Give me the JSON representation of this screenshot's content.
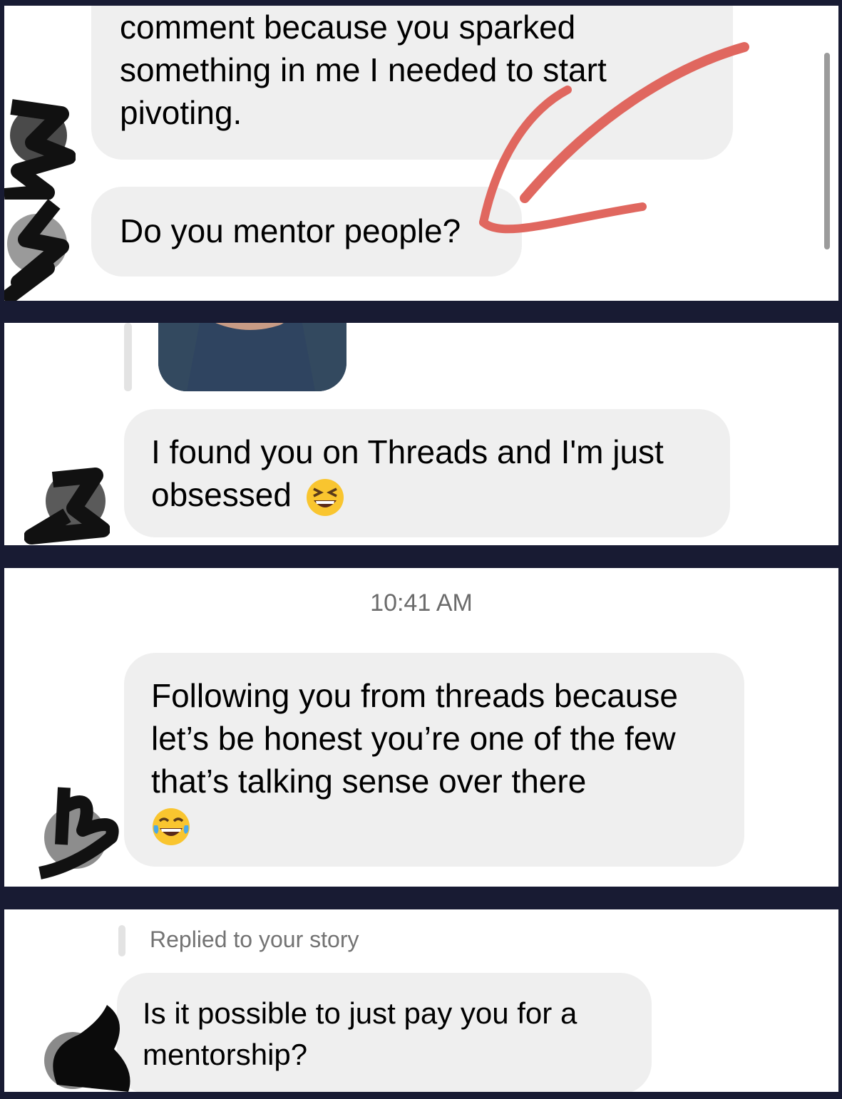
{
  "messages": [
    {
      "text": "comment because you sparked something in me I needed to start pivoting."
    },
    {
      "text": "Do you mentor people?"
    },
    {
      "text": "I found you on Threads and I'm just obsessed",
      "emoji": "grinning-squinting-face"
    },
    {
      "text": "Following you from threads because let’s be honest you’re one of the few that’s talking sense over there",
      "emoji": "face-with-tears-of-joy"
    },
    {
      "text": "Is it possible to just pay you for a mentorship?"
    }
  ],
  "timestamp": "10:41 AM",
  "reply_label": "Replied to your story",
  "colors": {
    "background": "#181b33",
    "bubble": "#efefef",
    "annotation_arrow": "#e0675f"
  }
}
